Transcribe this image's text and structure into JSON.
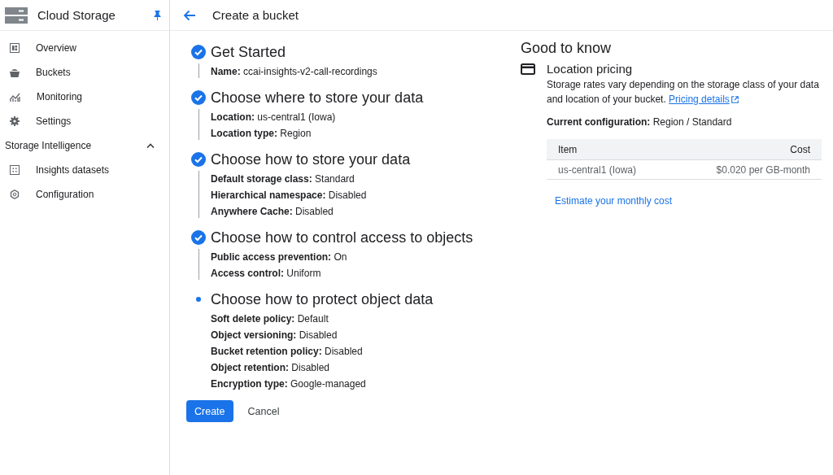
{
  "sidebar": {
    "title": "Cloud Storage",
    "pinned": true,
    "items": [
      {
        "label": "Overview",
        "selected": false
      },
      {
        "label": "Buckets",
        "selected": false
      },
      {
        "label": "Monitoring",
        "selected": false
      },
      {
        "label": "Settings",
        "selected": false
      }
    ],
    "sections": [
      {
        "label": "Storage Intelligence",
        "expanded": true,
        "items": [
          {
            "label": "Insights datasets",
            "selected": false
          },
          {
            "label": "Configuration",
            "selected": false
          }
        ]
      }
    ]
  },
  "header": {
    "title": "Create a bucket"
  },
  "steps": [
    {
      "title": "Get Started",
      "completed": true,
      "details": [
        "**Name:** ccai-insights-v2-call-recordings"
      ]
    },
    {
      "title": "Choose where to store your data",
      "completed": true,
      "details": [
        "**Location:** us-central1 (Iowa)",
        "**Location type:** Region"
      ]
    },
    {
      "title": "Choose how to store your data",
      "completed": true,
      "details": [
        "**Default storage class:** Standard",
        "**Hierarchical namespace:** Disabled",
        "**Anywhere Cache:** Disabled"
      ]
    },
    {
      "title": "Choose how to control access to objects",
      "completed": true,
      "details": [
        "**Public access prevention:** On",
        "**Access control:** Uniform"
      ]
    },
    {
      "title": "Choose how to protect object data",
      "completed": false,
      "details": [
        "**Soft delete policy:** Default",
        "**Object versioning:** Disabled",
        "**Bucket retention policy:** Disabled",
        "**Object retention:** Disabled",
        "**Encryption type:** Google-managed"
      ]
    }
  ],
  "buttons": {
    "primary": "Create",
    "secondary": "Cancel"
  },
  "info": {
    "title": "Good to know",
    "section_title": "Location pricing",
    "description": "Storage rates vary depending on the storage class of your data and location of your bucket.",
    "link": "Pricing details",
    "configuration": "**Current configuration:** Region / Standard",
    "table": {
      "columns": [
        "Item",
        "Cost"
      ],
      "rows": [
        [
          "us-central1 (Iowa)",
          "$0.020 per GB-month"
        ]
      ]
    },
    "estimate_link": "Estimate your monthly cost"
  }
}
